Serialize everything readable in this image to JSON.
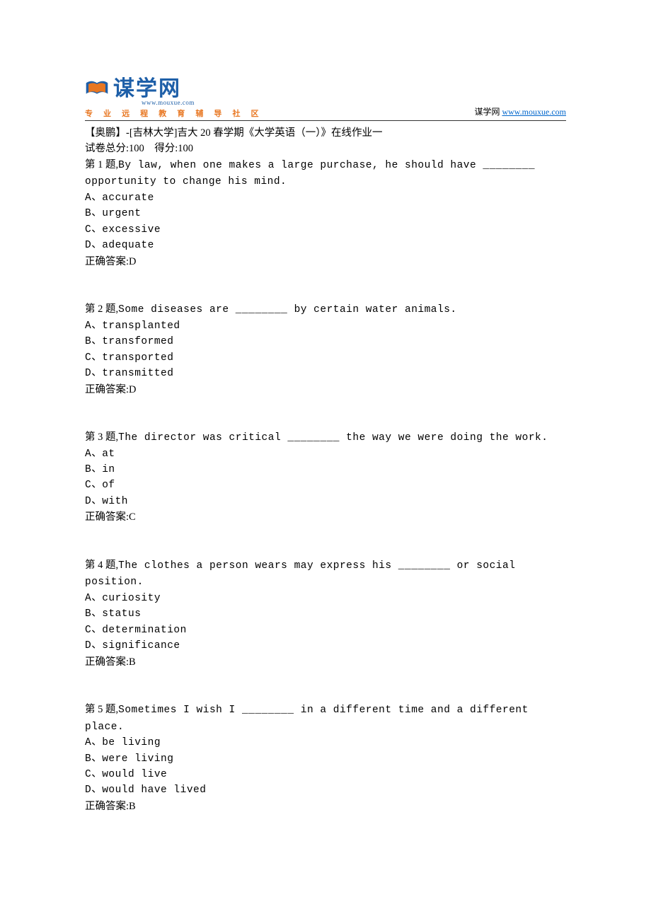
{
  "header": {
    "logo_main": "谋学网",
    "logo_url": "www.mouxue.com",
    "tagline": "专 业 远 程 教 育 辅 导 社 区",
    "right_text": "谋学网 ",
    "right_link": "www.mouxue.com"
  },
  "title": "【奥鹏】-[吉林大学]吉大 20 春学期《大学英语（一）》在线作业一",
  "score_line": "试卷总分:100    得分:100",
  "questions": [
    {
      "prefix": "第 1 题,",
      "text": "By law, when one makes a large purchase, he should have ________ opportunity to change his mind.",
      "options": [
        "A、accurate",
        "B、urgent",
        "C、excessive",
        "D、adequate"
      ],
      "answer": "正确答案:D"
    },
    {
      "prefix": "第 2 题,",
      "text": "Some diseases are ________ by certain water animals.",
      "options": [
        "A、transplanted",
        "B、transformed",
        "C、transported",
        "D、transmitted"
      ],
      "answer": "正确答案:D"
    },
    {
      "prefix": "第 3 题,",
      "text": "The director was critical ________ the way we were doing the work.",
      "options": [
        "A、at",
        "B、in",
        "C、of",
        "D、with"
      ],
      "answer": "正确答案:C"
    },
    {
      "prefix": "第 4 题,",
      "text": "The clothes a person wears may express his ________ or social position.",
      "options": [
        "A、curiosity",
        "B、status",
        "C、determination",
        "D、significance"
      ],
      "answer": "正确答案:B"
    },
    {
      "prefix": "第 5 题,",
      "text": "Sometimes I wish I ________ in a different time and a different place.",
      "options": [
        "A、be living",
        "B、were living",
        "C、would live",
        "D、would have lived"
      ],
      "answer": "正确答案:B"
    }
  ]
}
